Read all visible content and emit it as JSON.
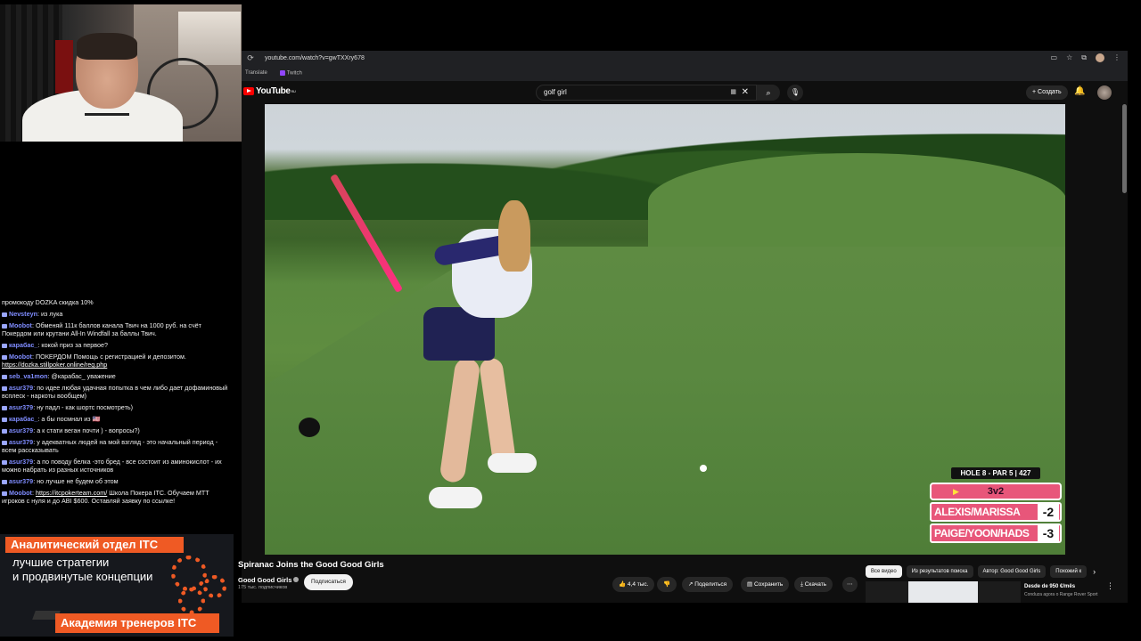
{
  "browser": {
    "url": "youtube.com/watch?v=gwTXXry678",
    "bookmarks": [
      "Translate",
      "Twitch"
    ]
  },
  "youtube": {
    "logo_text": "YouTube",
    "logo_sup": "RU",
    "search_query": "golf girl",
    "create_label": "+ Создать"
  },
  "video": {
    "title": "Spiranac Joins the Good Good Girls",
    "channel": "Good Good Girls",
    "subscribers": "175 тыс. подписчиков",
    "subscribe_label": "Подписаться",
    "likes": "4,4 тыс.",
    "share_label": "Поделиться",
    "save_label": "Сохранить",
    "download_label": "Скачать",
    "more": "⋯"
  },
  "scoreboard": {
    "hole": "HOLE 8 - PAR 5 | 427",
    "match": "3v2",
    "teams": [
      {
        "name": "ALEXIS/MARISSA",
        "score": "-2"
      },
      {
        "name": "PAIGE/YOON/HADS",
        "score": "-3"
      }
    ]
  },
  "related_tabs": [
    "Все видео",
    "Из результатов поиска",
    "Автор: Good Good Girls",
    "Похожий к"
  ],
  "ad": {
    "title": "Desde de 950 €/mês",
    "sub": "Conduza agora o Range Rover Sport"
  },
  "chat": [
    {
      "user": "",
      "text": "промокоду DOZKA скидка 10%"
    },
    {
      "user": "Nevsteyn",
      "text": "из лука"
    },
    {
      "user": "Moobot",
      "text": "Обменяй 111к баллов канала Твич на 1000 руб. на счёт Покердом или крутани All-In Windfall за баллы Твич."
    },
    {
      "user": "карабас_",
      "text": "кокой приз за первое?"
    },
    {
      "user": "Moobot",
      "text": "ПОКЕРДОМ Помощь с регистрацией и депозитом.",
      "link": "https://dozka.stillpoker.online/reg.php"
    },
    {
      "user": "seb_va1mon",
      "text": "@карабас_ уважение"
    },
    {
      "user": "asur379",
      "text": "по идее любая удачная попытка в чем либо дает дофаминовый всплеск - наркоты вообщем)"
    },
    {
      "user": "asur379",
      "text": "ну падл - как шортс посмотреть)"
    },
    {
      "user": "карабас_",
      "text": "а бы посмнал из 🇺🇸"
    },
    {
      "user": "asur379",
      "text": "а к стати веган почти ) - вопросы?)"
    },
    {
      "user": "asur379",
      "text": "у адекватных людей на мой взгляд - это начальный период - всем рассказывать"
    },
    {
      "user": "asur379",
      "text": "а по поводу белка -это бред - все состоит из аминокислот - их можно набрать из разных источников"
    },
    {
      "user": "asur379",
      "text": "но лучше не будем об этом"
    },
    {
      "user": "Moobot",
      "link": "https://itcpokerteam.com/",
      "text": "Школа Покера ITC. Обучаем МТТ игроков с нуля и до ABI $600. Оставляй заявку по ссылке!"
    }
  ],
  "promo": {
    "top": "Аналитический отдел ITC",
    "line1": "лучшие стратегии",
    "line2": "и продвинутые концепции",
    "bottom": "Академия тренеров ITC"
  },
  "colors": {
    "accent": "#ef5a24",
    "yt_red": "#ff0000",
    "score_pink": "#e8567a"
  }
}
